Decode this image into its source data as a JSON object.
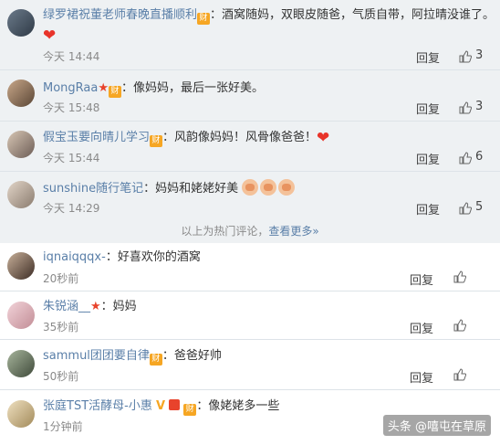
{
  "hot_comments": [
    {
      "name": "绿罗裙祝董老师春晚直播顺利",
      "text": "：酒窝随妈，双眼皮随爸，气质自带，阿拉晴没谁了。",
      "time": "今天 14:44",
      "reply": "回复",
      "likes": "3"
    },
    {
      "name": "MongRaa",
      "text": "：像妈妈，最后一张好美。",
      "time": "今天 15:48",
      "reply": "回复",
      "likes": "3"
    },
    {
      "name": "假宝玉要向晴儿学习",
      "text": "：风韵像妈妈！风骨像爸爸！",
      "time": "今天 15:44",
      "reply": "回复",
      "likes": "6"
    },
    {
      "name": "sunshine随行笔记",
      "text": "：妈妈和姥姥好美",
      "time": "今天 14:29",
      "reply": "回复",
      "likes": "5"
    }
  ],
  "divider": {
    "text": "以上为热门评论，",
    "more": "查看更多»"
  },
  "new_comments": [
    {
      "name": "iqnaiqqqx-",
      "text": "：好喜欢你的酒窝",
      "time": "20秒前",
      "reply": "回复"
    },
    {
      "name": "朱锐涵__",
      "text": "：妈妈",
      "time": "35秒前",
      "reply": "回复"
    },
    {
      "name": "sammul团团要自律",
      "text": "：爸爸好帅",
      "time": "50秒前",
      "reply": "回复"
    },
    {
      "name": "张庭TST活酵母-小惠",
      "text": "：像姥姥多一些",
      "time": "1分钟前",
      "reply": ""
    }
  ],
  "badges": {
    "v": "财"
  },
  "watermark": "头条 @嘻屯在草原",
  "colors": {
    "name": "#5a7fa8",
    "heart": "#e8342a",
    "bg_hot": "#eef1f3"
  }
}
